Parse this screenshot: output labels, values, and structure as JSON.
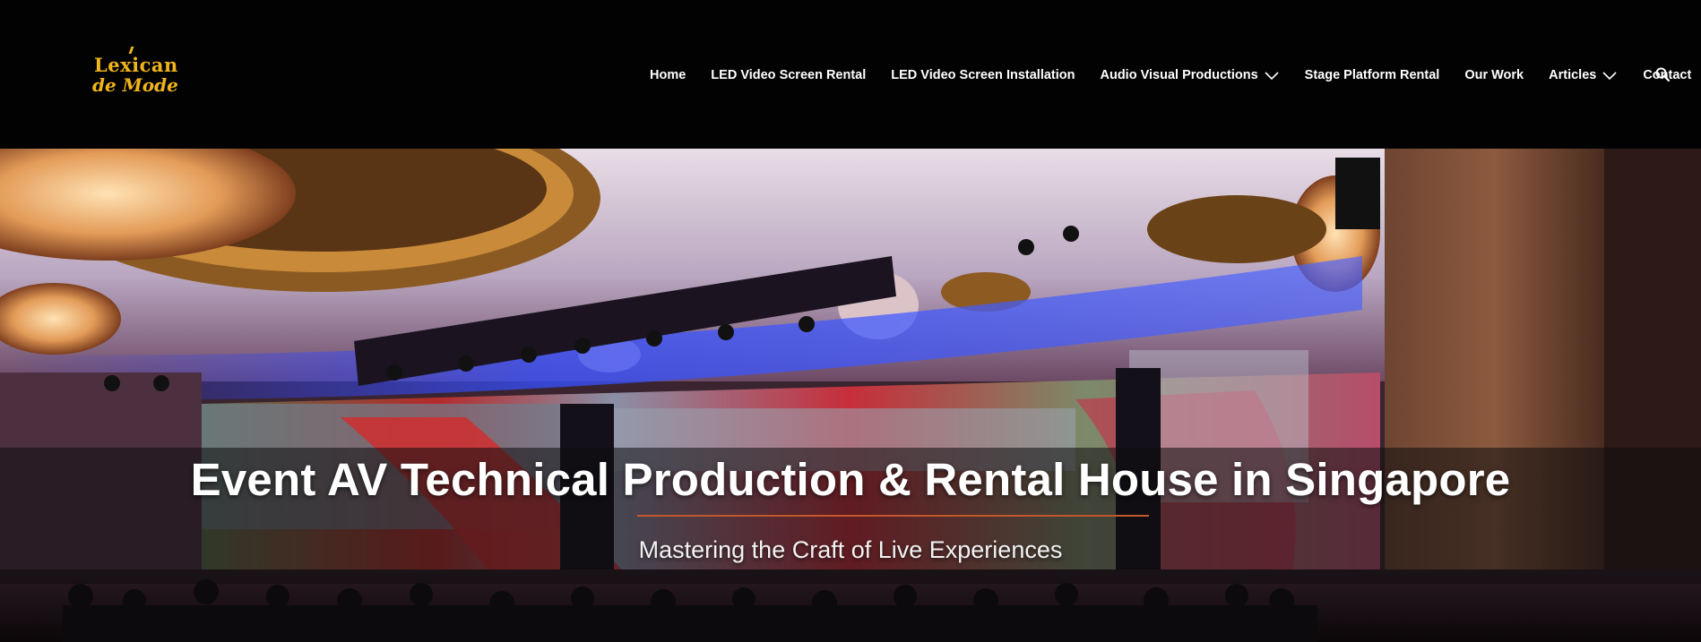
{
  "brand": {
    "logo_line1": "Lexican",
    "logo_line2": "de Mode",
    "logo_color": "#f0b41c"
  },
  "nav": {
    "items": [
      {
        "label": "Home",
        "has_dropdown": false
      },
      {
        "label": "LED Video Screen Rental",
        "has_dropdown": false
      },
      {
        "label": "LED Video Screen Installation",
        "has_dropdown": false
      },
      {
        "label": "Audio Visual Productions",
        "has_dropdown": true
      },
      {
        "label": "Stage Platform Rental",
        "has_dropdown": false
      },
      {
        "label": "Our Work",
        "has_dropdown": false
      },
      {
        "label": "Articles",
        "has_dropdown": true
      },
      {
        "label": "Contact",
        "has_dropdown": false
      }
    ],
    "search_icon": "search-icon"
  },
  "hero": {
    "title": "Event AV Technical Production & Rental House in Singapore",
    "subtitle": "Mastering the Craft of Live Experiences",
    "rule_color": "#c0582b"
  }
}
